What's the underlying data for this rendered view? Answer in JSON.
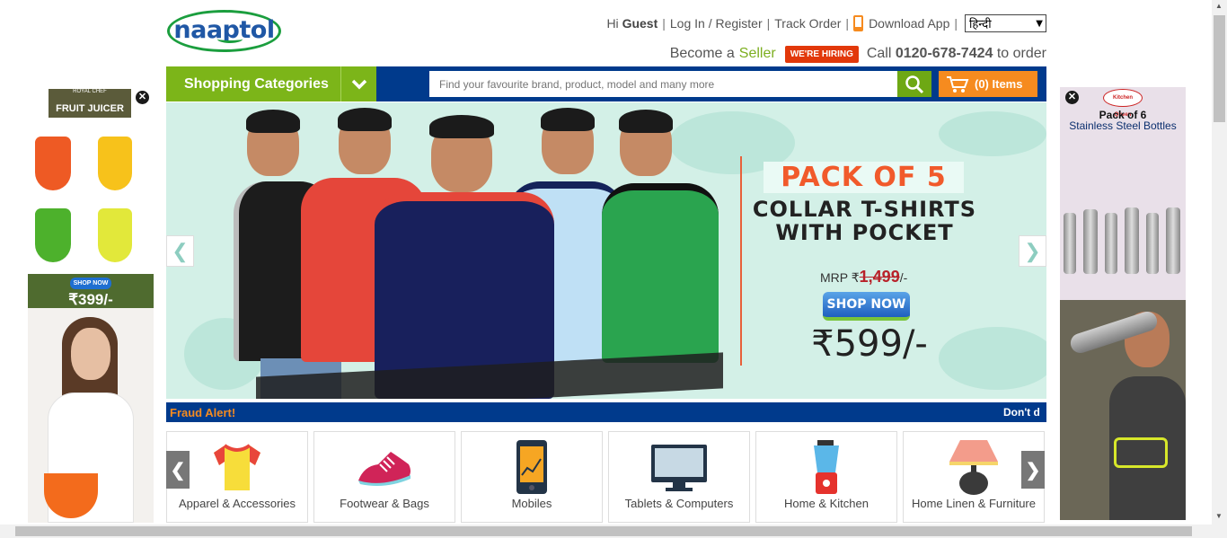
{
  "header": {
    "logo_text": "naaptol",
    "greeting_prefix": "Hi",
    "greeting_user": "Guest",
    "login_label": "Log In / Register",
    "track_order_label": "Track Order",
    "download_app_label": "Download App",
    "language_selected": "हिन्दी",
    "seller_prefix": "Become a",
    "seller_link": "Seller",
    "hiring_badge": "WE'RE HIRING",
    "call_prefix": "Call",
    "call_number": "0120-678-7424",
    "call_suffix": "to order"
  },
  "nav": {
    "categories_label": "Shopping Categories",
    "search_placeholder": "Find your favourite brand, product, model and many more",
    "cart_label": "(0) Items"
  },
  "banner": {
    "headline": "PACK OF 5",
    "subline1": "COLLAR T-SHIRTS",
    "subline2": "WITH POCKET",
    "mrp_label": "MRP ₹",
    "mrp_value": "1,499",
    "mrp_suffix": "/-",
    "shop_now_label": "SHOP NOW",
    "price": "₹599/-"
  },
  "fraud": {
    "label": "Fraud Alert!",
    "ticker": "Don't d"
  },
  "categories": [
    {
      "label": "Apparel & Accessories",
      "icon": "tshirt-icon"
    },
    {
      "label": "Footwear & Bags",
      "icon": "shoe-icon"
    },
    {
      "label": "Mobiles",
      "icon": "mobile-icon"
    },
    {
      "label": "Tablets & Computers",
      "icon": "monitor-icon"
    },
    {
      "label": "Home & Kitchen",
      "icon": "blender-icon"
    },
    {
      "label": "Home Linen & Furniture",
      "icon": "lamp-icon"
    }
  ],
  "left_ad": {
    "brand": "ROYAL CHEF",
    "title": "FRUIT JUICER",
    "cta": "SHOP NOW",
    "price": "₹399/-"
  },
  "right_ad": {
    "brand": "Kitchen Queen",
    "line1": "Pack of 6",
    "line2": "Stainless Steel Bottles"
  },
  "colors": {
    "brand_blue": "#003a8c",
    "brand_green": "#7cb519",
    "accent_orange": "#f68b1f",
    "banner_bg": "#d3f0e7"
  }
}
